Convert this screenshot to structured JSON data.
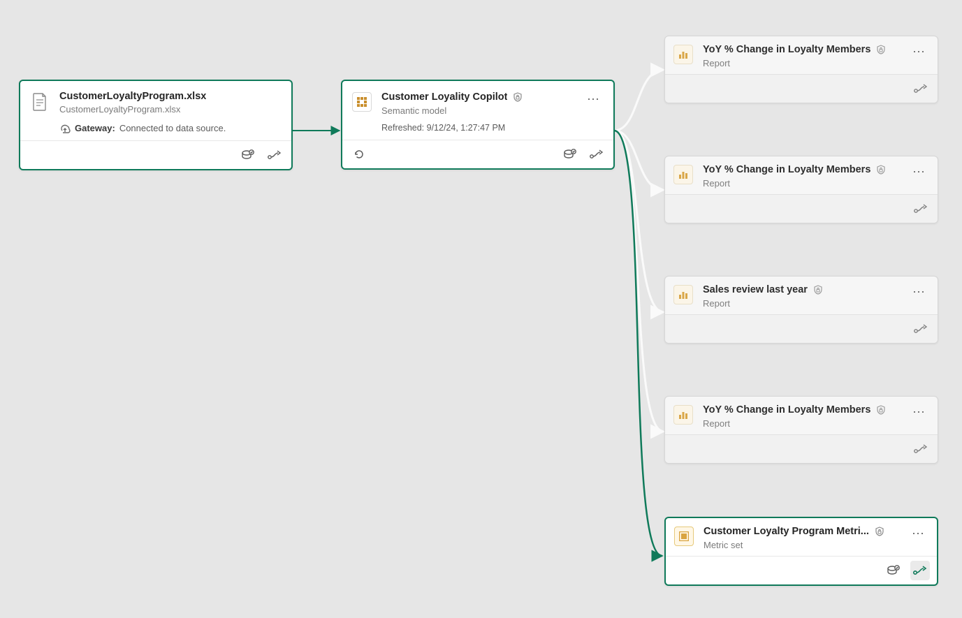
{
  "source": {
    "title": "CustomerLoyaltyProgram.xlsx",
    "subtitle": "CustomerLoyaltyProgram.xlsx",
    "gateway_label": "Gateway:",
    "gateway_status": "Connected to data source."
  },
  "semantic": {
    "title": "Customer Loyality Copilot",
    "subtitle": "Semantic model",
    "refreshed_label": "Refreshed: 9/12/24, 1:27:47 PM"
  },
  "outputs": [
    {
      "title": "YoY % Change in Loyalty Members",
      "type": "Report",
      "highlighted": false,
      "icon": "report"
    },
    {
      "title": "YoY % Change in Loyalty Members",
      "type": "Report",
      "highlighted": false,
      "icon": "report"
    },
    {
      "title": "Sales review last year",
      "type": "Report",
      "highlighted": false,
      "icon": "report"
    },
    {
      "title": "YoY % Change in Loyalty Members",
      "type": "Report",
      "highlighted": false,
      "icon": "report"
    },
    {
      "title": "Customer Loyalty Program Metri...",
      "type": "Metric set",
      "highlighted": true,
      "icon": "metric"
    }
  ],
  "colors": {
    "accent_green": "#0f7a5a",
    "canvas": "#e6e6e6"
  }
}
